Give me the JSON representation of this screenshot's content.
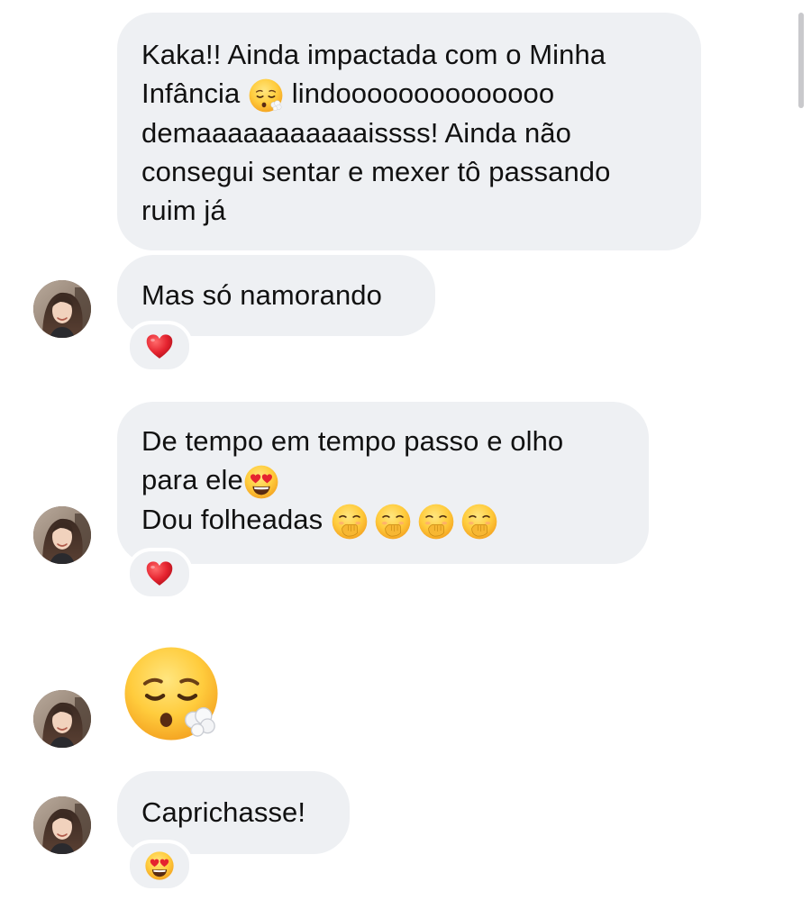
{
  "messages": [
    {
      "id": "msg1",
      "lines": [
        "Kaka!! Ainda impactada com o Minha",
        "Infância ",
        " lindoooooooooooooo",
        "demaaaaaaaaaaaissss! Ainda não",
        "consegui sentar e mexer tô passando",
        "ruim já"
      ],
      "inline_emoji": "face-exhaling"
    },
    {
      "id": "msg2",
      "text": "Mas só namorando",
      "reaction": "red-heart"
    },
    {
      "id": "msg3",
      "lines": [
        "De tempo em tempo passo e olho",
        "para ele",
        "Dou folheadas "
      ],
      "inline_emojis": [
        "smiling-face-with-heart-eyes",
        "face-with-hand-over-mouth",
        "face-with-hand-over-mouth",
        "face-with-hand-over-mouth",
        "face-with-hand-over-mouth"
      ],
      "reaction": "red-heart"
    },
    {
      "id": "msg4",
      "big_emoji": "face-exhaling"
    },
    {
      "id": "msg5",
      "text": "Caprichasse!",
      "reaction": "smiling-face-with-heart-eyes"
    }
  ],
  "colors": {
    "bubble": "#eef0f3",
    "text": "#111111",
    "heart": "#e5232f",
    "emoji_yellow": "#ffc93a"
  }
}
